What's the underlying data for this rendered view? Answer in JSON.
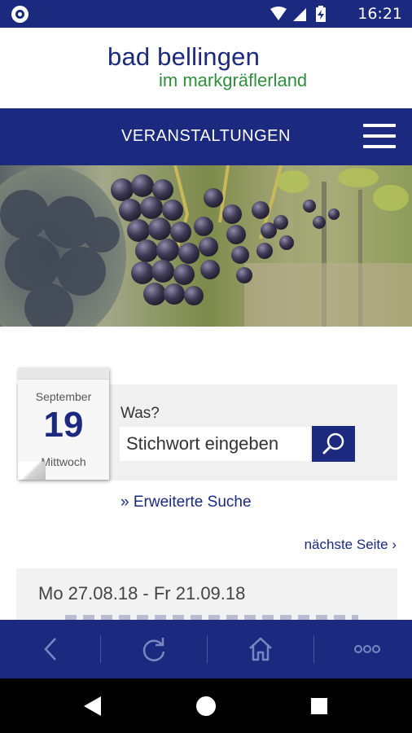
{
  "status_bar": {
    "time": "16:21",
    "icons": [
      "notification-icon",
      "wifi-icon",
      "signal-icon",
      "battery-charging-icon"
    ]
  },
  "brand": {
    "line1": "bad bellingen",
    "line2": "im markgräflerland",
    "primary_color": "#1b2a7e",
    "accent_color": "#2f8f3c"
  },
  "nav": {
    "title": "VERANSTALTUNGEN",
    "menu_icon": "hamburger-menu-icon"
  },
  "calendar": {
    "month": "September",
    "day": "19",
    "weekday": "Mittwoch"
  },
  "search": {
    "label": "Was?",
    "placeholder": "Stichwort eingeben",
    "button_icon": "search-icon",
    "advanced_link": "» Erweiterte Suche"
  },
  "pagination": {
    "next_label": "nächste Seite ›"
  },
  "events": [
    {
      "date_range": "Mo 27.08.18 - Fr 21.09.18"
    }
  ],
  "toolbar": {
    "items": [
      "back-icon",
      "reload-icon",
      "home-icon",
      "more-icon"
    ]
  },
  "android_nav": {
    "items": [
      "back-triangle-icon",
      "home-circle-icon",
      "recents-square-icon"
    ]
  }
}
